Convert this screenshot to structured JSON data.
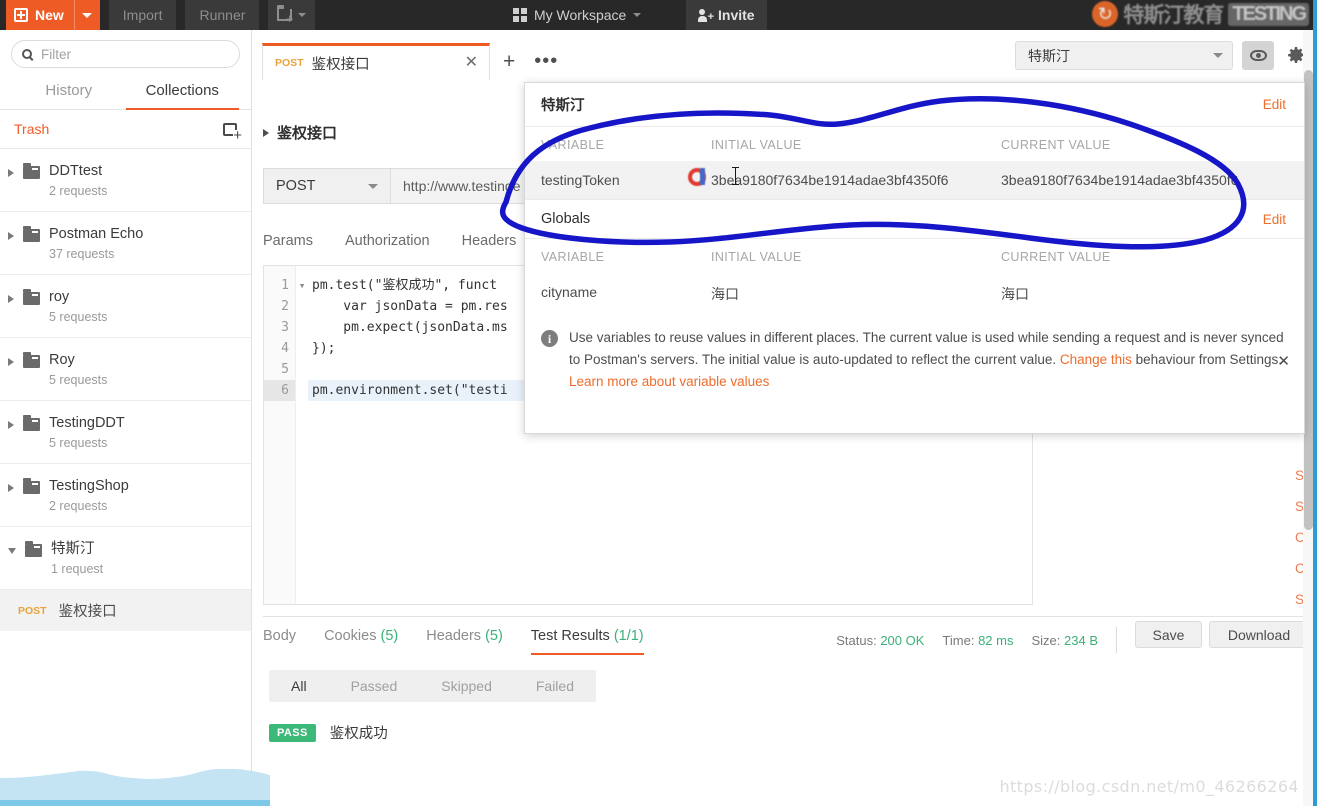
{
  "topbar": {
    "new_label": "New",
    "import_label": "Import",
    "runner_label": "Runner",
    "workspace_label": "My Workspace",
    "invite_label": "Invite",
    "watermark_text": "特斯汀教育",
    "watermark_chip": "TESTING"
  },
  "sidebar": {
    "search_placeholder": "Filter",
    "search_value": "",
    "tabs": [
      {
        "label": "History",
        "active": false
      },
      {
        "label": "Collections",
        "active": true
      }
    ],
    "trash_label": "Trash",
    "collections": [
      {
        "name": "DDTtest",
        "count": "2 requests",
        "expanded": false
      },
      {
        "name": "Postman Echo",
        "count": "37 requests",
        "expanded": false
      },
      {
        "name": "roy",
        "count": "5 requests",
        "expanded": false
      },
      {
        "name": "Roy",
        "count": "5 requests",
        "expanded": false
      },
      {
        "name": "TestingDDT",
        "count": "5 requests",
        "expanded": false
      },
      {
        "name": "TestingShop",
        "count": "2 requests",
        "expanded": false
      },
      {
        "name": "特斯汀",
        "count": "1 request",
        "expanded": true
      }
    ],
    "request_item": {
      "method": "POST",
      "name": "鉴权接口"
    }
  },
  "workarea": {
    "tab": {
      "method": "POST",
      "name": "鉴权接口",
      "close": "✕"
    },
    "new_tab_icon": "+",
    "more_icon": "•••",
    "breadcrumb": "鉴权接口",
    "method": "POST",
    "url": "http://www.testinge",
    "request_tabs": [
      "Params",
      "Authorization",
      "Headers"
    ],
    "environment_selected": "特斯汀"
  },
  "editor": {
    "lines": [
      {
        "n": "1",
        "fold": "▾",
        "highlight": false,
        "code": "pm.test(\"鉴权成功\", funct"
      },
      {
        "n": "2",
        "fold": "",
        "highlight": false,
        "code": "    var jsonData = pm.res"
      },
      {
        "n": "3",
        "fold": "",
        "highlight": false,
        "code": "    pm.expect(jsonData.ms"
      },
      {
        "n": "4",
        "fold": "",
        "highlight": false,
        "code": "});"
      },
      {
        "n": "5",
        "fold": "",
        "highlight": false,
        "code": ""
      },
      {
        "n": "6",
        "fold": "",
        "highlight": true,
        "code": "pm.environment.set(\"testi"
      }
    ]
  },
  "snippets": [
    "Set an environment variable",
    "Set a global variable",
    "Clear an environment variable",
    "Clear a global variable",
    "Send a request"
  ],
  "env_popup": {
    "environment": {
      "title": "特斯汀",
      "edit_label": "Edit",
      "columns": [
        "VARIABLE",
        "INITIAL VALUE",
        "CURRENT VALUE"
      ],
      "rows": [
        {
          "variable": "testingToken",
          "initial_value": "3bea9180f7634be1914adae3bf4350f6",
          "current_value": "3bea9180f7634be1914adae3bf4350f6"
        }
      ]
    },
    "globals": {
      "title": "Globals",
      "edit_label": "Edit",
      "columns": [
        "VARIABLE",
        "INITIAL VALUE",
        "CURRENT VALUE"
      ],
      "rows": [
        {
          "variable": "cityname",
          "initial_value": "海口",
          "current_value": "海口"
        }
      ]
    },
    "note": {
      "part1": "Use variables to reuse values in different places. The current value is used while sending a request and is never synced to Postman's servers. The initial value is auto-updated to reflect the current value. ",
      "link1": "Change this",
      "part2": " behaviour from Settings. ",
      "link2": "Learn more about variable values",
      "close": "✕"
    }
  },
  "response": {
    "tabs": [
      {
        "label": "Body",
        "count": "",
        "active": false
      },
      {
        "label": "Cookies",
        "count": "(5)",
        "active": false
      },
      {
        "label": "Headers",
        "count": "(5)",
        "active": false
      },
      {
        "label": "Test Results",
        "count": "(1/1)",
        "active": true
      }
    ],
    "status_label": "Status:",
    "status_value": "200 OK",
    "time_label": "Time:",
    "time_value": "82 ms",
    "size_label": "Size:",
    "size_value": "234 B",
    "save_label": "Save",
    "download_label": "Download",
    "filters": [
      {
        "label": "All",
        "active": true
      },
      {
        "label": "Passed",
        "active": false
      },
      {
        "label": "Skipped",
        "active": false
      },
      {
        "label": "Failed",
        "active": false
      }
    ],
    "results": [
      {
        "badge": "PASS",
        "name": "鉴权成功"
      }
    ]
  },
  "watermark": {
    "url": "https://blog.csdn.net/m0_46266264"
  },
  "colors": {
    "accent": "#ef5b25",
    "green": "#3bb077",
    "annotation": "#1616c8",
    "cursor_ring": "#e03a30"
  }
}
